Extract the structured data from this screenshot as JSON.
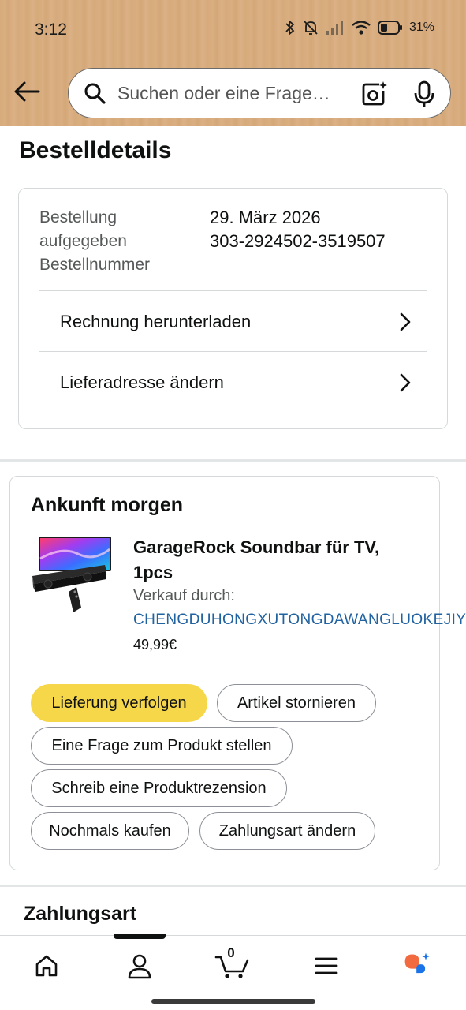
{
  "status_bar": {
    "time": "3:12",
    "battery_percent": "31%"
  },
  "search": {
    "placeholder": "Suchen oder eine Frage…"
  },
  "page": {
    "title": "Bestelldetails"
  },
  "order": {
    "label_placed": "Bestellung aufgegeben",
    "label_number": "Bestellnummer",
    "date": "29. März 2026",
    "number": "303-2924502-3519507",
    "download_invoice": "Rechnung herunterladen",
    "change_address": "Lieferadresse ändern"
  },
  "shipment": {
    "title": "Ankunft morgen",
    "product_name": "GarageRock Soundbar für TV, 1pcs",
    "sold_by_label": "Verkauf durch:",
    "seller": "CHENGDUHONGXUTONGDAWANGLUOKEJIY",
    "price": "49,99€",
    "buttons": {
      "track": "Lieferung verfolgen",
      "cancel": "Artikel stornieren",
      "ask": "Eine Frage zum Produkt stellen",
      "review": "Schreib eine Produktrezension",
      "buy_again": "Nochmals kaufen",
      "change_payment": "Zahlungsart ändern"
    }
  },
  "payment": {
    "title": "Zahlungsart"
  },
  "nav": {
    "cart_count": "0",
    "active": "account",
    "items": [
      "home-icon",
      "account-icon",
      "cart-icon",
      "menu-icon",
      "rufus-icon"
    ]
  },
  "colors": {
    "header_bg": "#d7ab7c",
    "primary_button": "#f7d74a",
    "link": "#2162a1",
    "rufus_orange": "#f26a3f",
    "rufus_blue": "#1a73e8"
  }
}
